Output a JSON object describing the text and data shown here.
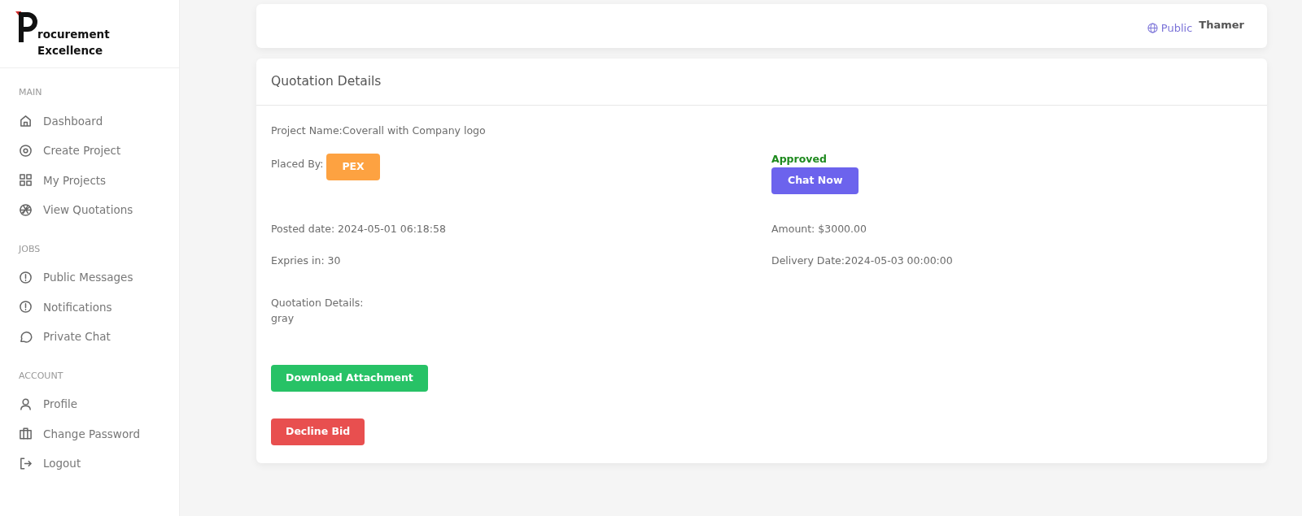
{
  "logo": {
    "text": "rocurement Excellence"
  },
  "sidebar": {
    "sections": [
      {
        "heading": "MAIN",
        "items": [
          {
            "label": "Dashboard"
          },
          {
            "label": "Create Project"
          },
          {
            "label": "My Projects"
          },
          {
            "label": "View Quotations"
          }
        ]
      },
      {
        "heading": "JOBS",
        "items": [
          {
            "label": "Public Messages"
          },
          {
            "label": "Notifications"
          },
          {
            "label": "Private Chat"
          }
        ]
      },
      {
        "heading": "ACCOUNT",
        "items": [
          {
            "label": "Profile"
          },
          {
            "label": "Change Password"
          },
          {
            "label": "Logout"
          }
        ]
      }
    ]
  },
  "topbar": {
    "visibility": "Public",
    "user": "Thamer"
  },
  "card": {
    "title": "Quotation Details",
    "project_name": "Project Name:Coverall with Company logo",
    "placed_by_label": "Placed By:",
    "placed_by": "PEX",
    "status": "Approved",
    "chat_button": "Chat Now",
    "posted_date": "Posted date: 2024-05-01 06:18:58",
    "amount": "Amount: $3000.00",
    "expires": "Expries in: 30",
    "delivery_date": "Delivery Date:2024-05-03 00:00:00",
    "details_label": "Quotation Details:",
    "details_value": "gray",
    "download_button": "Download Attachment",
    "decline_button": "Decline Bid"
  }
}
